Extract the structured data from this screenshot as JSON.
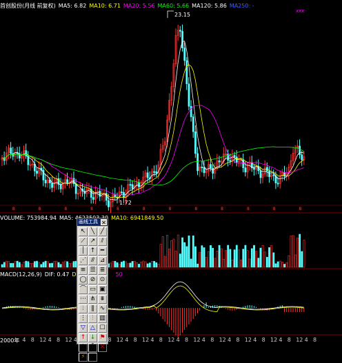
{
  "price_panel": {
    "header": {
      "stock": "首创股份(月线 前复权)",
      "ma5": "MA5: 6.82",
      "ma10": "MA10: 6.71",
      "ma20": "MA20: 5.56",
      "ma60": "MA60: 5.66",
      "ma120": "MA120: 5.86",
      "ma250": "MA250: -"
    },
    "high_label": "23.15",
    "low_label": "1.72",
    "corner_marker": "xxx",
    "colors": {
      "ma5": "#ffffff",
      "ma10": "#ffff00",
      "ma20": "#ff00ff",
      "ma60": "#00ff00",
      "ma120": "#ffffff",
      "ma250": "#0000ff",
      "up": "#ff3232",
      "down": "#54ffff"
    }
  },
  "volume_panel": {
    "header": {
      "volume": "VOLUME: 753984.94",
      "ma5": "MA5: 4623503.30",
      "ma10": "MA10: 6941849.50"
    }
  },
  "macd_panel": {
    "header": {
      "title": "MACD(12,26,9)",
      "dif": "DIF: 0.47",
      "dea": "DEA:",
      "macd": "50"
    }
  },
  "time_axis": {
    "labels": [
      "2000年",
      "4",
      "8",
      "12",
      "4",
      "8",
      "12",
      "4",
      "8",
      "12",
      "4",
      "8",
      "12",
      "4",
      "8",
      "12",
      "4",
      "8",
      "12",
      "4",
      "8",
      "12",
      "4",
      "8",
      "12",
      "4",
      "8",
      "12",
      "4",
      "8",
      "12",
      "4",
      "8",
      "12",
      "4",
      "8"
    ]
  },
  "toolbox": {
    "title": "画线工具",
    "close": "✕",
    "tools": [
      {
        "icon": "cursor-icon",
        "glyph": "↖"
      },
      {
        "icon": "line-segment-icon",
        "glyph": "╲"
      },
      {
        "icon": "ray-line-icon",
        "glyph": "╱"
      },
      {
        "icon": "straight-line-icon",
        "glyph": "⟋"
      },
      {
        "icon": "arrow-line-icon",
        "glyph": "↗"
      },
      {
        "icon": "parallel-line-icon",
        "glyph": "⫽"
      },
      {
        "icon": "vertical-line-icon",
        "glyph": "│"
      },
      {
        "icon": "horizontal-line-icon",
        "glyph": "↑"
      },
      {
        "icon": "price-line-icon",
        "glyph": "━"
      },
      {
        "icon": "channel-icon",
        "glyph": "⋰"
      },
      {
        "icon": "trend-channel-icon",
        "glyph": "⫻"
      },
      {
        "icon": "regression-icon",
        "glyph": "⊿"
      },
      {
        "icon": "fibonacci-icon",
        "glyph": "≡"
      },
      {
        "icon": "gann-icon",
        "glyph": "☰"
      },
      {
        "icon": "golden-ratio-icon",
        "glyph": "≣"
      },
      {
        "icon": "circle-icon",
        "glyph": "◯"
      },
      {
        "icon": "cycle-icon",
        "glyph": "⊘"
      },
      {
        "icon": "ellipse-icon",
        "glyph": "⊙"
      },
      {
        "icon": "arc-icon",
        "glyph": "⌒"
      },
      {
        "icon": "rectangle-icon",
        "glyph": "▭"
      },
      {
        "icon": "square-icon",
        "glyph": "▣"
      },
      {
        "icon": "speed-line-icon",
        "glyph": "⋯"
      },
      {
        "icon": "gann-fan-icon",
        "glyph": "⋔"
      },
      {
        "icon": "resistance-icon",
        "glyph": "⩩"
      },
      {
        "icon": "time-zone-icon",
        "glyph": "⦙"
      },
      {
        "icon": "bars-pattern-icon",
        "glyph": "‖"
      },
      {
        "icon": "wave-icon",
        "glyph": "∿"
      },
      {
        "icon": "period-icon",
        "glyph": "⋮"
      },
      {
        "icon": "fan-lines-icon",
        "glyph": "⫶"
      },
      {
        "icon": "grid-icon",
        "glyph": "▥"
      },
      {
        "icon": "triangle-icon",
        "glyph": "▽"
      },
      {
        "icon": "up-triangle-icon",
        "glyph": "△"
      },
      {
        "icon": "box-icon",
        "glyph": "☐"
      },
      {
        "icon": "up-arrow-icon",
        "glyph": "↑"
      },
      {
        "icon": "down-arrow-icon",
        "glyph": "↓"
      },
      {
        "icon": "flag-icon",
        "glyph": "⚑"
      },
      {
        "icon": "text-icon",
        "glyph": "A"
      },
      {
        "icon": "text-note-icon",
        "glyph": "Ā"
      },
      {
        "icon": "delete-icon",
        "glyph": "✕"
      },
      {
        "icon": "hide-icon",
        "glyph": "⚡"
      },
      {
        "icon": "save-icon",
        "glyph": "▦"
      }
    ]
  }
}
